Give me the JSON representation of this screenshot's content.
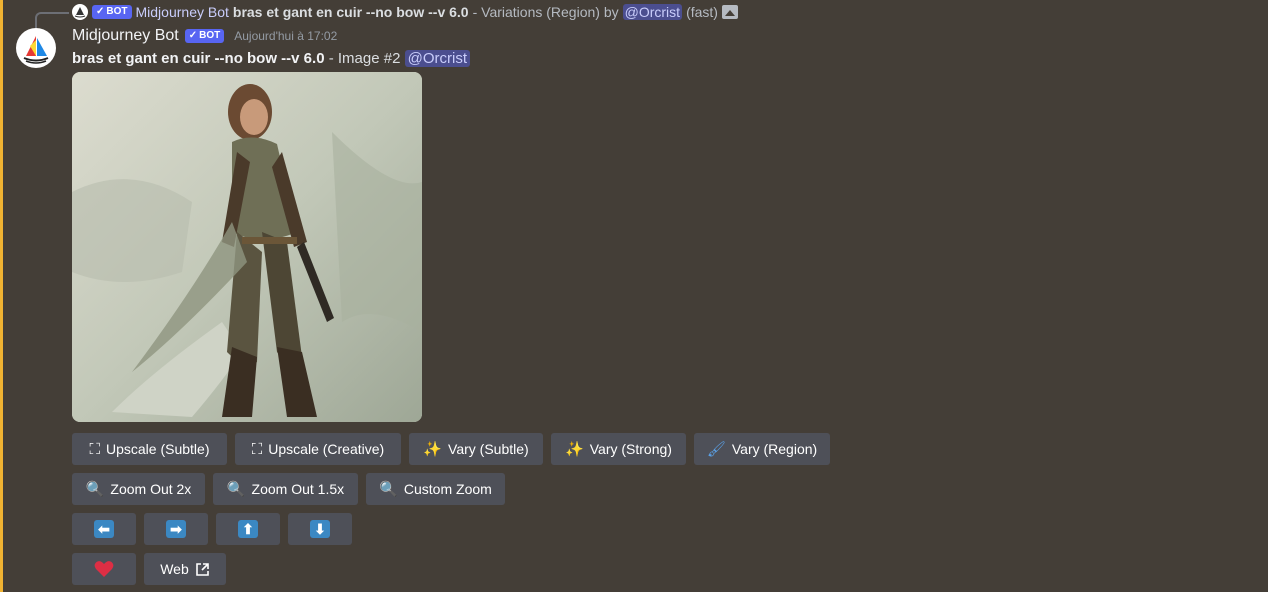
{
  "reply": {
    "author": "Midjourney Bot",
    "badge": "BOT",
    "prompt": "bras et gant en cuir --no bow --v 6.0",
    "suffix": "- Variations (Region) by",
    "mention": "@Orcrist",
    "speed": "(fast)"
  },
  "message": {
    "author": "Midjourney Bot",
    "badge": "BOT",
    "timestamp": "Aujourd'hui à 17:02",
    "prompt": "bras et gant en cuir --no bow --v 6.0",
    "image_label": "- Image #2",
    "mention": "@Orcrist"
  },
  "buttons": {
    "row1": [
      "Upscale (Subtle)",
      "Upscale (Creative)",
      "Vary (Subtle)",
      "Vary (Strong)",
      "Vary (Region)"
    ],
    "row2": [
      "Zoom Out 2x",
      "Zoom Out 1.5x",
      "Custom Zoom"
    ],
    "arrows": [
      "⬅",
      "➡",
      "⬆",
      "⬇"
    ],
    "web_label": "Web"
  },
  "colors": {
    "accent": "#f0b232",
    "button": "#4e5058",
    "badge": "#5865f2",
    "background": "#443e37"
  }
}
